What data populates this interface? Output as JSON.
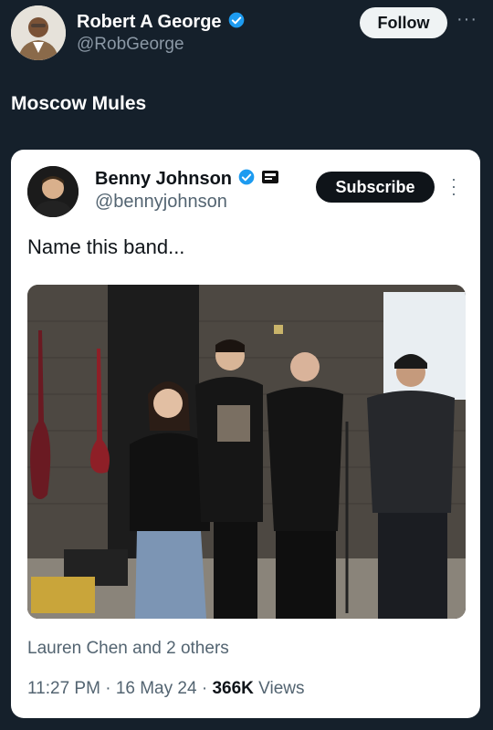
{
  "author": {
    "name": "Robert A George",
    "handle": "@RobGeorge",
    "verified": true
  },
  "follow_label": "Follow",
  "more_icon": "more-horizontal-icon",
  "tweet_text": "Moscow Mules",
  "embed": {
    "author_name": "Benny Johnson",
    "author_handle": "@bennyjohnson",
    "verified": true,
    "affiliate_badge": "affiliate-badge-icon",
    "subscribe_label": "Subscribe",
    "text": "Name this band...",
    "tagged": "Lauren Chen and 2 others",
    "time": "11:27 PM",
    "date": "16 May 24",
    "sep": "·",
    "views_count": "366K",
    "views_label": "Views"
  },
  "colors": {
    "background": "#15202b",
    "verified": "#1d9bf0",
    "card": "#ffffff"
  }
}
